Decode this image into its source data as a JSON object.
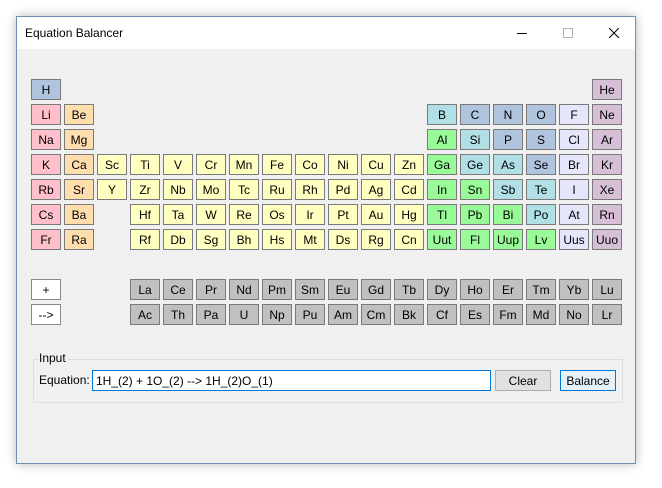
{
  "window": {
    "title": "Equation Balancer"
  },
  "colors": {
    "alkali": "#ffc0cb",
    "alkaline_earth": "#ffdead",
    "transition": "#ffffc0",
    "post_transition": "#cccccc",
    "metalloid": "#b0e0e6",
    "nonmetal": "#b0c4de",
    "halogen": "#e6e6fa",
    "noble_gas": "#d8bfd8",
    "hydrogen": "#b0c4de",
    "basic_metal": "#98fb98",
    "lanthanide_actinide": "#c0c0c0"
  },
  "table": {
    "rows": [
      [
        {
          "sym": "H",
          "col": 0,
          "type": "hydrogen"
        },
        {
          "sym": "He",
          "col": 17,
          "type": "noble_gas"
        }
      ],
      [
        {
          "sym": "Li",
          "col": 0,
          "type": "alkali"
        },
        {
          "sym": "Be",
          "col": 1,
          "type": "alkaline_earth"
        },
        {
          "sym": "B",
          "col": 12,
          "type": "metalloid"
        },
        {
          "sym": "C",
          "col": 13,
          "type": "nonmetal"
        },
        {
          "sym": "N",
          "col": 14,
          "type": "nonmetal"
        },
        {
          "sym": "O",
          "col": 15,
          "type": "nonmetal"
        },
        {
          "sym": "F",
          "col": 16,
          "type": "halogen"
        },
        {
          "sym": "Ne",
          "col": 17,
          "type": "noble_gas"
        }
      ],
      [
        {
          "sym": "Na",
          "col": 0,
          "type": "alkali"
        },
        {
          "sym": "Mg",
          "col": 1,
          "type": "alkaline_earth"
        },
        {
          "sym": "Al",
          "col": 12,
          "type": "basic_metal"
        },
        {
          "sym": "Si",
          "col": 13,
          "type": "metalloid"
        },
        {
          "sym": "P",
          "col": 14,
          "type": "nonmetal"
        },
        {
          "sym": "S",
          "col": 15,
          "type": "nonmetal"
        },
        {
          "sym": "Cl",
          "col": 16,
          "type": "halogen"
        },
        {
          "sym": "Ar",
          "col": 17,
          "type": "noble_gas"
        }
      ],
      [
        {
          "sym": "K",
          "col": 0,
          "type": "alkali"
        },
        {
          "sym": "Ca",
          "col": 1,
          "type": "alkaline_earth"
        },
        {
          "sym": "Sc",
          "col": 2,
          "type": "transition"
        },
        {
          "sym": "Ti",
          "col": 3,
          "type": "transition"
        },
        {
          "sym": "V",
          "col": 4,
          "type": "transition"
        },
        {
          "sym": "Cr",
          "col": 5,
          "type": "transition"
        },
        {
          "sym": "Mn",
          "col": 6,
          "type": "transition"
        },
        {
          "sym": "Fe",
          "col": 7,
          "type": "transition"
        },
        {
          "sym": "Co",
          "col": 8,
          "type": "transition"
        },
        {
          "sym": "Ni",
          "col": 9,
          "type": "transition"
        },
        {
          "sym": "Cu",
          "col": 10,
          "type": "transition"
        },
        {
          "sym": "Zn",
          "col": 11,
          "type": "transition"
        },
        {
          "sym": "Ga",
          "col": 12,
          "type": "basic_metal"
        },
        {
          "sym": "Ge",
          "col": 13,
          "type": "metalloid"
        },
        {
          "sym": "As",
          "col": 14,
          "type": "metalloid"
        },
        {
          "sym": "Se",
          "col": 15,
          "type": "nonmetal"
        },
        {
          "sym": "Br",
          "col": 16,
          "type": "halogen"
        },
        {
          "sym": "Kr",
          "col": 17,
          "type": "noble_gas"
        }
      ],
      [
        {
          "sym": "Rb",
          "col": 0,
          "type": "alkali"
        },
        {
          "sym": "Sr",
          "col": 1,
          "type": "alkaline_earth"
        },
        {
          "sym": "Y",
          "col": 2,
          "type": "transition"
        },
        {
          "sym": "Zr",
          "col": 3,
          "type": "transition"
        },
        {
          "sym": "Nb",
          "col": 4,
          "type": "transition"
        },
        {
          "sym": "Mo",
          "col": 5,
          "type": "transition"
        },
        {
          "sym": "Tc",
          "col": 6,
          "type": "transition"
        },
        {
          "sym": "Ru",
          "col": 7,
          "type": "transition"
        },
        {
          "sym": "Rh",
          "col": 8,
          "type": "transition"
        },
        {
          "sym": "Pd",
          "col": 9,
          "type": "transition"
        },
        {
          "sym": "Ag",
          "col": 10,
          "type": "transition"
        },
        {
          "sym": "Cd",
          "col": 11,
          "type": "transition"
        },
        {
          "sym": "In",
          "col": 12,
          "type": "basic_metal"
        },
        {
          "sym": "Sn",
          "col": 13,
          "type": "basic_metal"
        },
        {
          "sym": "Sb",
          "col": 14,
          "type": "metalloid"
        },
        {
          "sym": "Te",
          "col": 15,
          "type": "metalloid"
        },
        {
          "sym": "I",
          "col": 16,
          "type": "halogen"
        },
        {
          "sym": "Xe",
          "col": 17,
          "type": "noble_gas"
        }
      ],
      [
        {
          "sym": "Cs",
          "col": 0,
          "type": "alkali"
        },
        {
          "sym": "Ba",
          "col": 1,
          "type": "alkaline_earth"
        },
        {
          "sym": "Hf",
          "col": 3,
          "type": "transition"
        },
        {
          "sym": "Ta",
          "col": 4,
          "type": "transition"
        },
        {
          "sym": "W",
          "col": 5,
          "type": "transition"
        },
        {
          "sym": "Re",
          "col": 6,
          "type": "transition"
        },
        {
          "sym": "Os",
          "col": 7,
          "type": "transition"
        },
        {
          "sym": "Ir",
          "col": 8,
          "type": "transition"
        },
        {
          "sym": "Pt",
          "col": 9,
          "type": "transition"
        },
        {
          "sym": "Au",
          "col": 10,
          "type": "transition"
        },
        {
          "sym": "Hg",
          "col": 11,
          "type": "transition"
        },
        {
          "sym": "Tl",
          "col": 12,
          "type": "basic_metal"
        },
        {
          "sym": "Pb",
          "col": 13,
          "type": "basic_metal"
        },
        {
          "sym": "Bi",
          "col": 14,
          "type": "basic_metal"
        },
        {
          "sym": "Po",
          "col": 15,
          "type": "metalloid"
        },
        {
          "sym": "At",
          "col": 16,
          "type": "halogen"
        },
        {
          "sym": "Rn",
          "col": 17,
          "type": "noble_gas"
        }
      ],
      [
        {
          "sym": "Fr",
          "col": 0,
          "type": "alkali"
        },
        {
          "sym": "Ra",
          "col": 1,
          "type": "alkaline_earth"
        },
        {
          "sym": "Rf",
          "col": 3,
          "type": "transition"
        },
        {
          "sym": "Db",
          "col": 4,
          "type": "transition"
        },
        {
          "sym": "Sg",
          "col": 5,
          "type": "transition"
        },
        {
          "sym": "Bh",
          "col": 6,
          "type": "transition"
        },
        {
          "sym": "Hs",
          "col": 7,
          "type": "transition"
        },
        {
          "sym": "Mt",
          "col": 8,
          "type": "transition"
        },
        {
          "sym": "Ds",
          "col": 9,
          "type": "transition"
        },
        {
          "sym": "Rg",
          "col": 10,
          "type": "transition"
        },
        {
          "sym": "Cn",
          "col": 11,
          "type": "transition"
        },
        {
          "sym": "Uut",
          "col": 12,
          "type": "basic_metal"
        },
        {
          "sym": "Fl",
          "col": 13,
          "type": "basic_metal"
        },
        {
          "sym": "Uup",
          "col": 14,
          "type": "basic_metal"
        },
        {
          "sym": "Lv",
          "col": 15,
          "type": "basic_metal"
        },
        {
          "sym": "Uus",
          "col": 16,
          "type": "halogen"
        },
        {
          "sym": "Uuo",
          "col": 17,
          "type": "noble_gas"
        }
      ]
    ],
    "lanthanides": [
      "La",
      "Ce",
      "Pr",
      "Nd",
      "Pm",
      "Sm",
      "Eu",
      "Gd",
      "Tb",
      "Dy",
      "Ho",
      "Er",
      "Tm",
      "Yb",
      "Lu"
    ],
    "actinides": [
      "Ac",
      "Th",
      "Pa",
      "U",
      "Np",
      "Pu",
      "Am",
      "Cm",
      "Bk",
      "Cf",
      "Es",
      "Fm",
      "Md",
      "No",
      "Lr"
    ]
  },
  "operators": {
    "plus": "+",
    "arrow": "-->"
  },
  "input": {
    "group_label": "Input",
    "equation_label": "Equation:",
    "equation_value": "1H_(2) + 1O_(2) --> 1H_(2)O_(1)",
    "clear_label": "Clear",
    "balance_label": "Balance"
  }
}
